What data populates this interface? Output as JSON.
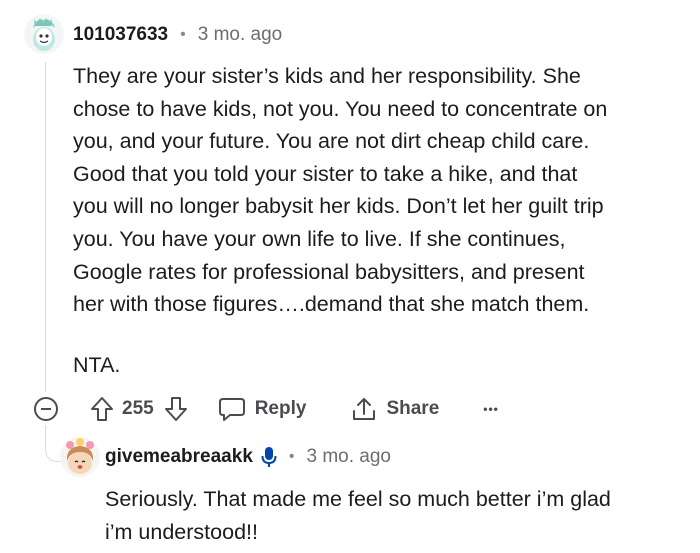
{
  "comment": {
    "username": "101037633",
    "separator": "•",
    "time": "3 mo. ago",
    "lines": [
      "They are your sister’s kids and her responsibility. She",
      "chose to have kids, not you. You need to concentrate on",
      "you, and your future. You are not dirt cheap child care.",
      "Good that you told your sister to take a hike, and that",
      "you will no longer babysit her kids. Don’t let her guilt trip",
      "you. You have your own life to live. If she continues,",
      "Google rates for professional babysitters, and present",
      "her with those figures….demand that she match them."
    ],
    "verdict": "NTA.",
    "score": "255",
    "reply_label": "Reply",
    "share_label": "Share",
    "more_label": "•••"
  },
  "reply": {
    "username": "givemeabreaakk",
    "separator": "•",
    "time": "3 mo. ago",
    "lines": [
      "Seriously. That made me feel so much better i’m glad",
      "i’m understood!!"
    ]
  },
  "icons": {
    "collapse": "collapse-minus-icon",
    "upvote": "upvote-arrow-icon",
    "downvote": "downvote-arrow-icon",
    "reply": "speech-bubble-icon",
    "share": "share-upload-icon",
    "more": "more-dots-icon",
    "mic": "microphone-icon"
  },
  "colors": {
    "text": "#1c1c1c",
    "meta": "#6b6e70",
    "action": "#4a4d50",
    "mic": "#0045ac",
    "thread_line": "#dcdcdc"
  }
}
